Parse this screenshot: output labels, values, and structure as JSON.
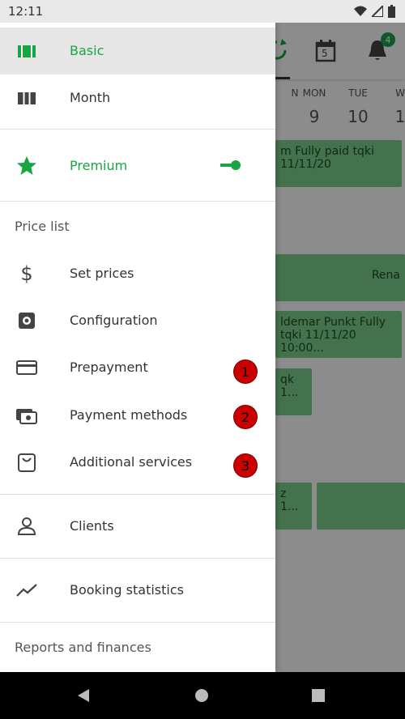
{
  "status_bar": {
    "time": "12:11"
  },
  "background": {
    "toolbar": {
      "calendar_day": "5",
      "notifications_count": "4"
    },
    "days": [
      {
        "name": "N",
        "num": ""
      },
      {
        "name": "MON",
        "num": "9"
      },
      {
        "name": "TUE",
        "num": "10"
      },
      {
        "name": "W",
        "num": "1"
      }
    ],
    "events": [
      "m Fully paid tqki\n11/11/20",
      "Rena",
      "ldemar Punkt Fully\ntqki 11/11/20 10:00...",
      "qk\n1...",
      "z\n1..."
    ]
  },
  "drawer": {
    "basic": "Basic",
    "month": "Month",
    "premium": "Premium",
    "section_price_list": "Price list",
    "set_prices": "Set prices",
    "configuration": "Configuration",
    "prepayment": "Prepayment",
    "payment_methods": "Payment methods",
    "additional_services": "Additional services",
    "clients": "Clients",
    "booking_statistics": "Booking statistics",
    "section_reports": "Reports and finances",
    "badges": [
      "1",
      "2",
      "3"
    ]
  },
  "colors": {
    "accent": "#18a544",
    "badge": "#cc0000"
  },
  "icons": [
    "basic-icon",
    "month-icon",
    "star-icon",
    "dollar-icon",
    "gear-icon",
    "card-icon",
    "payment-methods-icon",
    "bag-icon",
    "person-icon",
    "trend-icon"
  ]
}
